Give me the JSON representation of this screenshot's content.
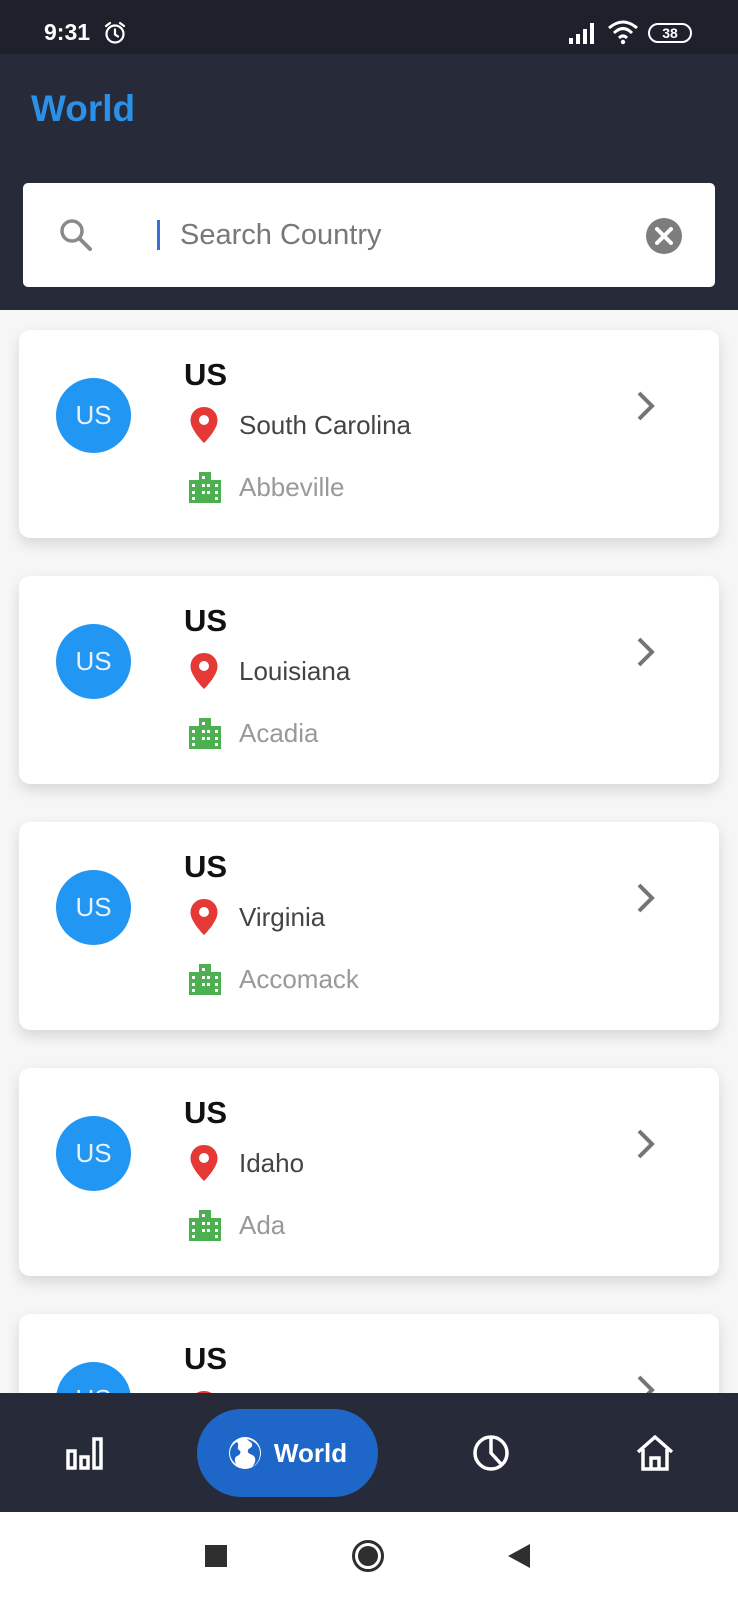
{
  "status_bar": {
    "time": "9:31",
    "battery": "38"
  },
  "header": {
    "title": "World"
  },
  "search": {
    "placeholder": "Search Country",
    "value": ""
  },
  "cards": [
    {
      "avatar": "US",
      "country": "US",
      "state": "South Carolina",
      "county": "Abbeville"
    },
    {
      "avatar": "US",
      "country": "US",
      "state": "Louisiana",
      "county": "Acadia"
    },
    {
      "avatar": "US",
      "country": "US",
      "state": "Virginia",
      "county": "Accomack"
    },
    {
      "avatar": "US",
      "country": "US",
      "state": "Idaho",
      "county": "Ada"
    },
    {
      "avatar": "US",
      "country": "US",
      "state": "",
      "county": ""
    }
  ],
  "bottom_nav": {
    "items": [
      {
        "icon": "bar-chart-icon"
      },
      {
        "icon": "globe-icon",
        "label": "World",
        "active": true
      },
      {
        "icon": "pie-chart-icon"
      },
      {
        "icon": "home-icon"
      }
    ]
  },
  "colors": {
    "header_bg": "#272a38",
    "title": "#2b91e8",
    "avatar": "#2196f3",
    "pin": "#e53935",
    "building": "#4caf50",
    "active_nav": "#1e66c7"
  }
}
